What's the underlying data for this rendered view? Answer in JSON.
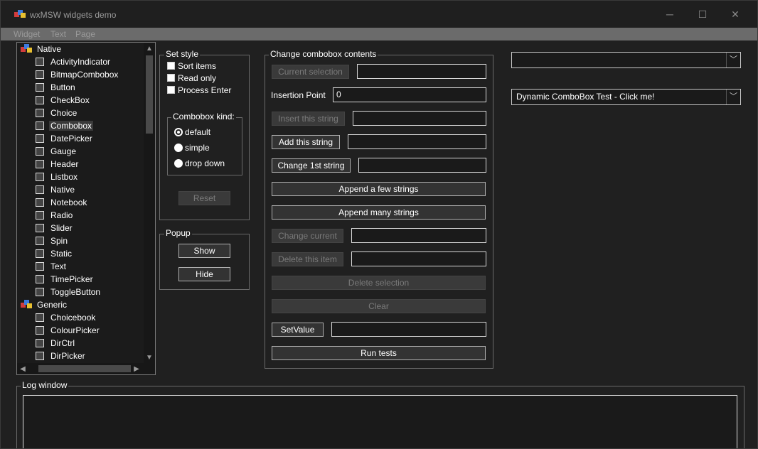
{
  "window": {
    "title": "wxMSW widgets demo",
    "controls": {
      "minimize": "─",
      "maximize": "☐",
      "close": "✕"
    }
  },
  "menubar": {
    "items": [
      "Widget",
      "Text",
      "Page"
    ]
  },
  "tree": {
    "items": [
      {
        "label": "Native",
        "icon": "native-category-icon",
        "level": 0
      },
      {
        "label": "ActivityIndicator",
        "icon": "activity-indicator-icon",
        "level": 1
      },
      {
        "label": "BitmapCombobox",
        "icon": "bitmap-combobox-icon",
        "level": 1
      },
      {
        "label": "Button",
        "icon": "button-icon",
        "level": 1
      },
      {
        "label": "CheckBox",
        "icon": "checkbox-icon",
        "level": 1
      },
      {
        "label": "Choice",
        "icon": "choice-icon",
        "level": 1
      },
      {
        "label": "Combobox",
        "icon": "combobox-icon",
        "level": 1,
        "selected": true
      },
      {
        "label": "DatePicker",
        "icon": "datepicker-icon",
        "level": 1
      },
      {
        "label": "Gauge",
        "icon": "gauge-icon",
        "level": 1
      },
      {
        "label": "Header",
        "icon": "header-icon",
        "level": 1
      },
      {
        "label": "Listbox",
        "icon": "listbox-icon",
        "level": 1
      },
      {
        "label": "Native",
        "icon": "native-icon",
        "level": 1
      },
      {
        "label": "Notebook",
        "icon": "notebook-icon",
        "level": 1
      },
      {
        "label": "Radio",
        "icon": "radio-icon",
        "level": 1
      },
      {
        "label": "Slider",
        "icon": "slider-icon",
        "level": 1
      },
      {
        "label": "Spin",
        "icon": "spin-icon",
        "level": 1
      },
      {
        "label": "Static",
        "icon": "static-icon",
        "level": 1
      },
      {
        "label": "Text",
        "icon": "text-icon",
        "level": 1
      },
      {
        "label": "TimePicker",
        "icon": "timepicker-icon",
        "level": 1
      },
      {
        "label": "ToggleButton",
        "icon": "togglebutton-icon",
        "level": 1
      },
      {
        "label": "Generic",
        "icon": "generic-category-icon",
        "level": 0
      },
      {
        "label": "Choicebook",
        "icon": "choicebook-icon",
        "level": 1
      },
      {
        "label": "ColourPicker",
        "icon": "colourpicker-icon",
        "level": 1
      },
      {
        "label": "DirCtrl",
        "icon": "dirctrl-icon",
        "level": 1
      },
      {
        "label": "DirPicker",
        "icon": "dirpicker-icon",
        "level": 1
      }
    ]
  },
  "set_style": {
    "title": "Set style",
    "sort_items": "Sort items",
    "read_only": "Read only",
    "process_enter": "Process Enter",
    "kind_title": "Combobox kind:",
    "kind_default": "default",
    "kind_simple": "simple",
    "kind_dropdown": "drop down",
    "reset": "Reset"
  },
  "popup": {
    "title": "Popup",
    "show": "Show",
    "hide": "Hide"
  },
  "change": {
    "title": "Change combobox contents",
    "current_selection": "Current selection",
    "insertion_point_label": "Insertion Point",
    "insertion_point_value": "0",
    "insert_string": "Insert this string",
    "add_string": "Add this string",
    "change_first": "Change 1st string",
    "append_few": "Append a few strings",
    "append_many": "Append many strings",
    "change_current": "Change current",
    "delete_item": "Delete this item",
    "delete_selection": "Delete selection",
    "clear": "Clear",
    "set_value": "SetValue",
    "run_tests": "Run tests"
  },
  "combos": {
    "top_value": "",
    "dynamic_value": "Dynamic ComboBox Test - Click me!"
  },
  "log": {
    "title": "Log window"
  }
}
